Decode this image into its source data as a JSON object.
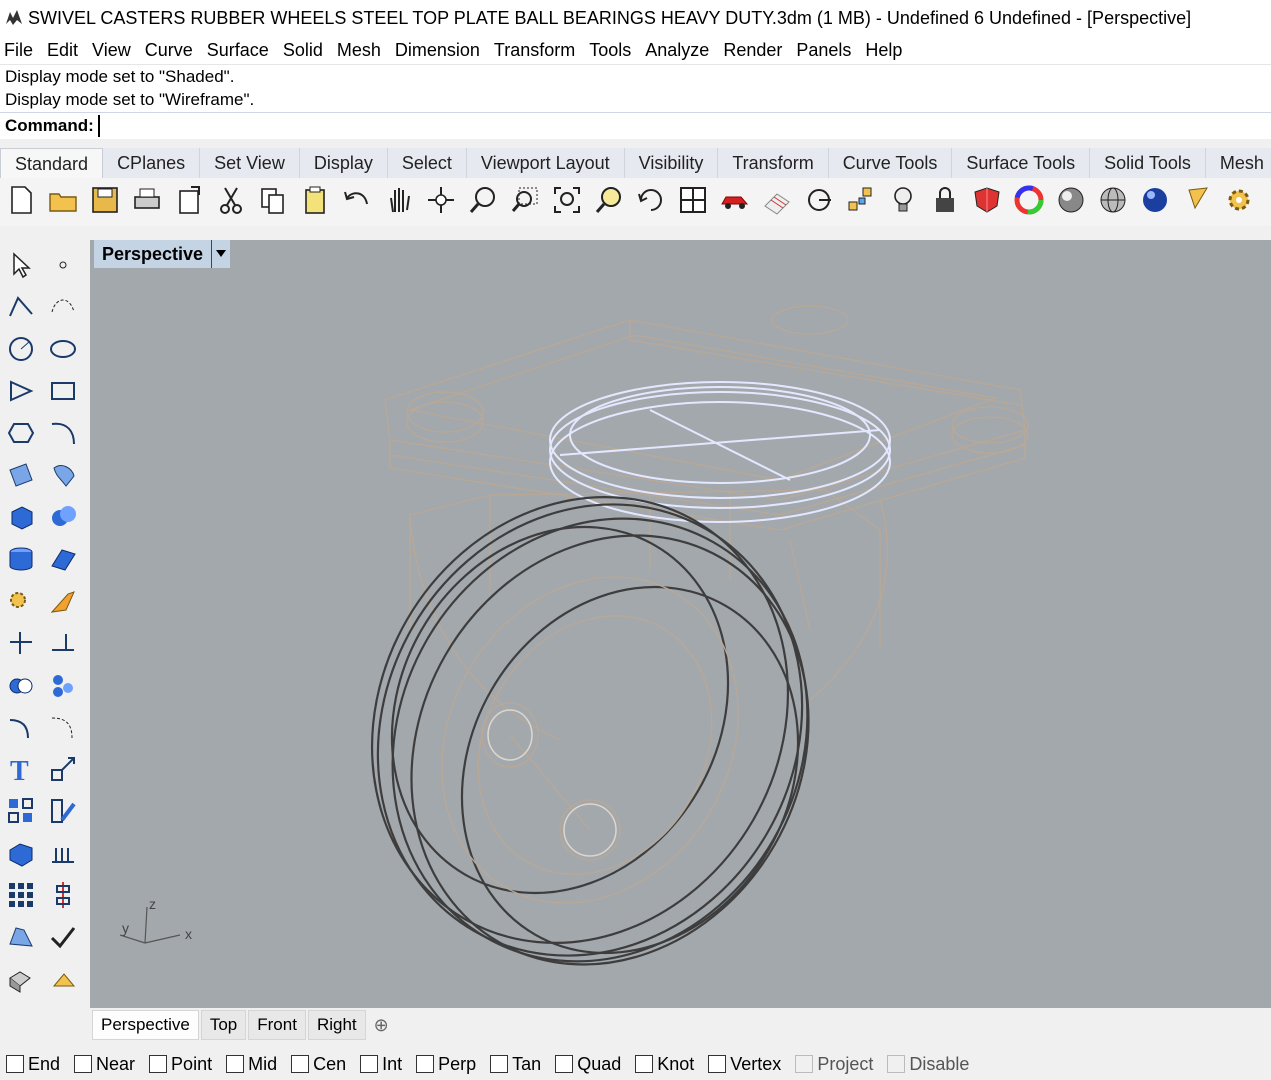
{
  "window": {
    "title": "SWIVEL CASTERS RUBBER WHEELS STEEL TOP PLATE BALL BEARINGS HEAVY DUTY.3dm (1 MB) - Undefined 6 Undefined - [Perspective]"
  },
  "menu": [
    "File",
    "Edit",
    "View",
    "Curve",
    "Surface",
    "Solid",
    "Mesh",
    "Dimension",
    "Transform",
    "Tools",
    "Analyze",
    "Render",
    "Panels",
    "Help"
  ],
  "history": [
    "Display mode set to \"Shaded\".",
    "Display mode set to \"Wireframe\"."
  ],
  "command": {
    "label": "Command:",
    "value": ""
  },
  "toolbar_tabs": [
    "Standard",
    "CPlanes",
    "Set View",
    "Display",
    "Select",
    "Viewport Layout",
    "Visibility",
    "Transform",
    "Curve Tools",
    "Surface Tools",
    "Solid Tools",
    "Mesh"
  ],
  "toolbar_icons": [
    "new-file-icon",
    "open-folder-icon",
    "save-icon",
    "print-icon",
    "import-icon",
    "cut-icon",
    "copy-icon",
    "paste-icon",
    "undo-icon",
    "pan-hand-icon",
    "rotate-view-icon",
    "zoom-icon",
    "zoom-window-icon",
    "zoom-extents-icon",
    "zoom-selected-icon",
    "rotate-camera-icon",
    "four-viewports-icon",
    "car-icon",
    "grid-icon",
    "cplane-icon",
    "points-icon",
    "light-bulb-icon",
    "lock-icon",
    "material-icon",
    "color-wheel-icon",
    "sphere-shaded-icon",
    "sphere-wireframe-icon",
    "sphere-blue-icon",
    "snapshot-icon",
    "gear-icon"
  ],
  "side_icons": [
    "select-arrow-icon",
    "point-icon",
    "polyline-icon",
    "curve-icon",
    "circle-icon",
    "ellipse-icon",
    "polygon-icon",
    "rectangle-icon",
    "hexagon-icon",
    "arc-icon",
    "surface-icon",
    "surface-patch-icon",
    "box-icon",
    "sphere-icon",
    "cylinder-icon",
    "plane-icon",
    "explode-icon",
    "trim-icon",
    "split-icon",
    "join-icon",
    "boolean-icon",
    "group-icon",
    "fillet-icon",
    "offset-icon",
    "text-icon",
    "scale-icon",
    "array-icon",
    "edit-icon",
    "extrude-icon",
    "dimension-icon",
    "grid-array-icon",
    "align-icon",
    "analyze-icon",
    "check-icon",
    "solid-icon",
    "paint-icon"
  ],
  "viewport": {
    "label": "Perspective",
    "axes": {
      "x": "x",
      "y": "y",
      "z": "z"
    }
  },
  "view_tabs": [
    "Perspective",
    "Top",
    "Front",
    "Right"
  ],
  "osnaps": [
    {
      "label": "End",
      "enabled": true
    },
    {
      "label": "Near",
      "enabled": true
    },
    {
      "label": "Point",
      "enabled": true
    },
    {
      "label": "Mid",
      "enabled": true
    },
    {
      "label": "Cen",
      "enabled": true
    },
    {
      "label": "Int",
      "enabled": true
    },
    {
      "label": "Perp",
      "enabled": true
    },
    {
      "label": "Tan",
      "enabled": true
    },
    {
      "label": "Quad",
      "enabled": true
    },
    {
      "label": "Knot",
      "enabled": true
    },
    {
      "label": "Vertex",
      "enabled": true
    },
    {
      "label": "Project",
      "enabled": false
    },
    {
      "label": "Disable",
      "enabled": false
    }
  ],
  "colors": {
    "viewport_bg": "#a3a8ad",
    "wire_tan": "#b9a896",
    "wire_dark": "#3d3d3d",
    "wire_highlight": "#e4e8ff",
    "label_bg": "#c5d4e5"
  }
}
